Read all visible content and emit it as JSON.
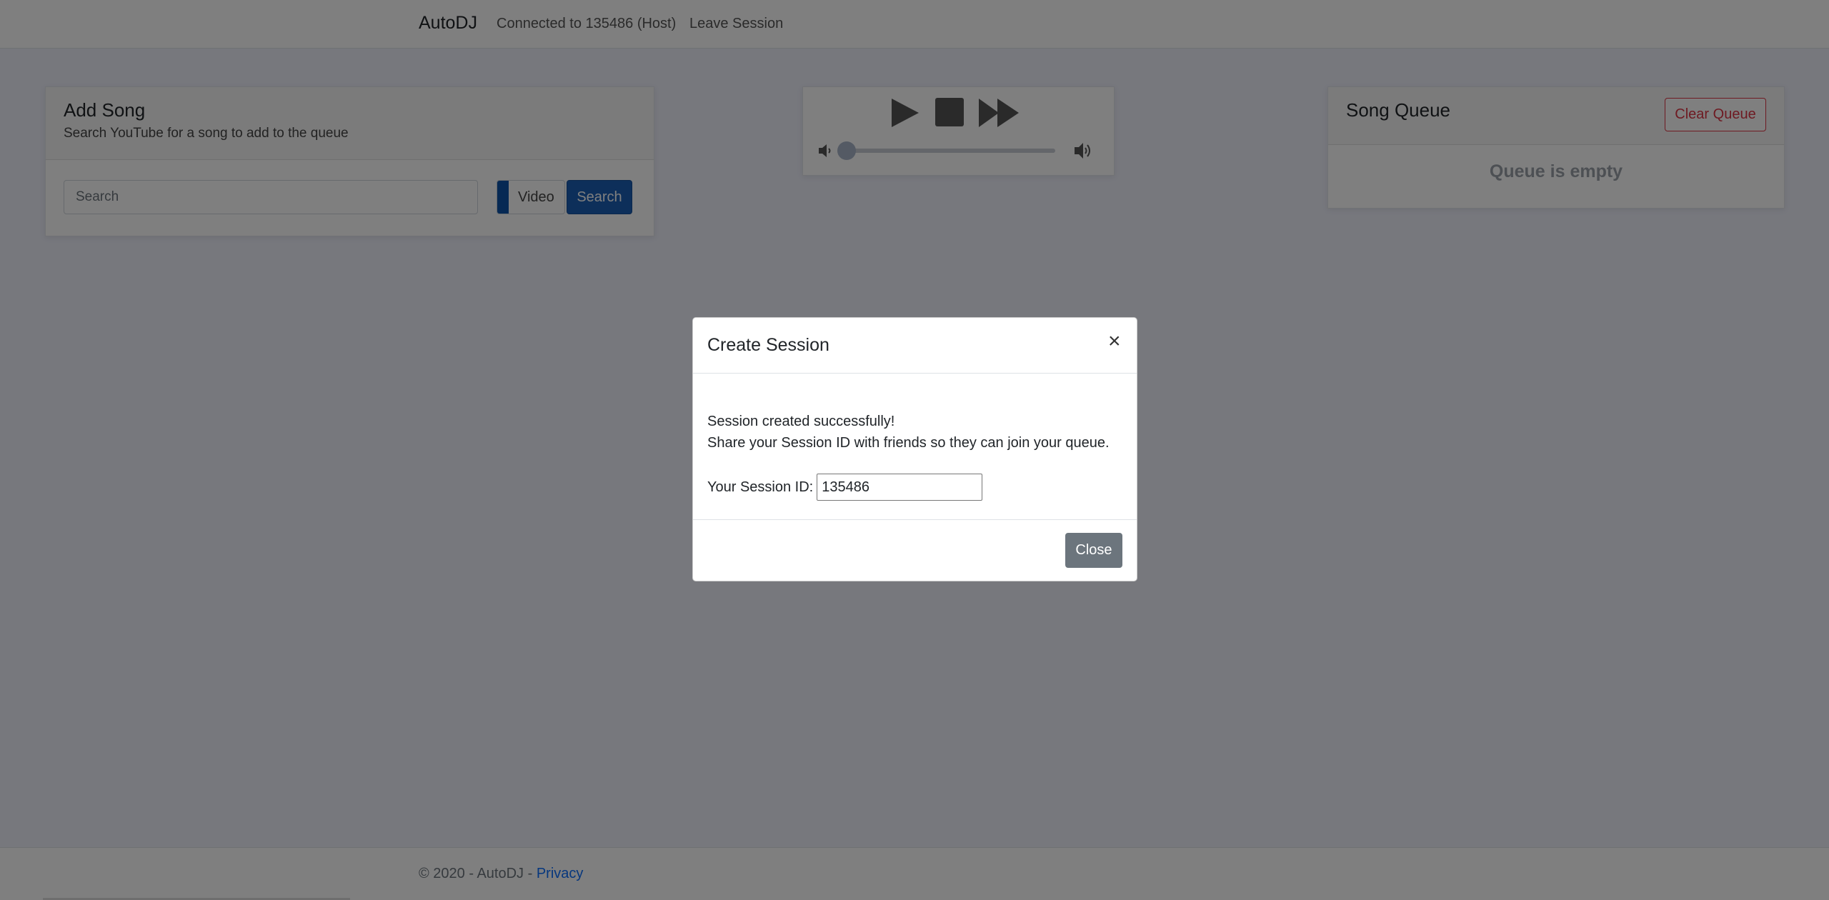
{
  "navbar": {
    "brand": "AutoDJ",
    "status": "Connected to 135486 (Host)",
    "leave": "Leave Session"
  },
  "add_song": {
    "title": "Add Song",
    "subtitle": "Search YouTube for a song to add to the queue",
    "search_placeholder": "Search",
    "video_label": "Video",
    "search_button": "Search"
  },
  "player": {
    "play_icon": "play-icon",
    "stop_icon": "stop-icon",
    "skip_icon": "fast-forward-icon",
    "volume_level": 0
  },
  "queue": {
    "title": "Song Queue",
    "clear_button": "Clear Queue",
    "empty_text": "Queue is empty"
  },
  "footer": {
    "copyright": "© 2020 - AutoDJ - ",
    "privacy": "Privacy"
  },
  "modal": {
    "title": "Create Session",
    "close_symbol": "×",
    "line1": "Session created successfully!",
    "line2": "Share your Session ID with friends so they can join your queue.",
    "id_label": "Your Session ID:",
    "id_value": "135486",
    "close_button": "Close"
  },
  "colors": {
    "primary": "#1b5fb5",
    "danger": "#dc3545",
    "secondary": "#6c757d"
  }
}
